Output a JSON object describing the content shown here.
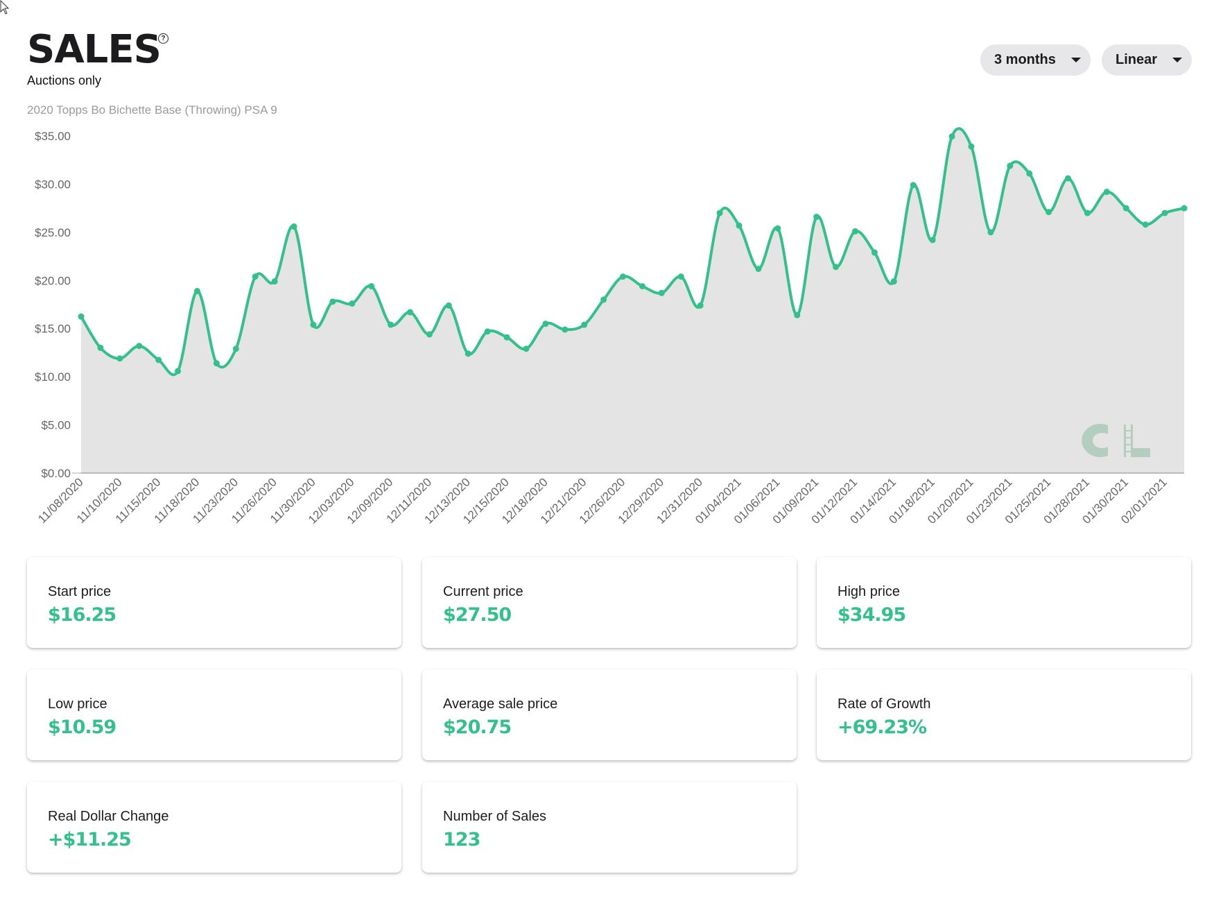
{
  "header": {
    "title": "SALES",
    "help_icon": "question-circle-icon",
    "subtitle": "Auctions only",
    "card_name": "2020 Topps Bo Bichette Base (Throwing) PSA 9"
  },
  "controls": {
    "range_label": "3 months",
    "scale_label": "Linear"
  },
  "colors": {
    "accent": "#32c08b",
    "area_fill": "#e4e4e4",
    "text": "#1c1c1e"
  },
  "chart_data": {
    "type": "area",
    "title": "",
    "xlabel": "",
    "ylabel": "",
    "ylim": [
      0,
      35
    ],
    "y_ticks": [
      "$0.00",
      "$5.00",
      "$10.00",
      "$15.00",
      "$20.00",
      "$25.00",
      "$30.00",
      "$35.00"
    ],
    "y_tick_values": [
      0,
      5,
      10,
      15,
      20,
      25,
      30,
      35
    ],
    "x_tick_labels": [
      "11/08/2020",
      "11/10/2020",
      "11/15/2020",
      "11/18/2020",
      "11/23/2020",
      "11/26/2020",
      "11/30/2020",
      "12/03/2020",
      "12/09/2020",
      "12/11/2020",
      "12/13/2020",
      "12/15/2020",
      "12/18/2020",
      "12/21/2020",
      "12/26/2020",
      "12/29/2020",
      "12/31/2020",
      "01/04/2021",
      "01/06/2021",
      "01/09/2021",
      "01/12/2021",
      "01/14/2021",
      "01/18/2021",
      "01/20/2021",
      "01/23/2021",
      "01/25/2021",
      "01/28/2021",
      "01/30/2021",
      "02/01/2021"
    ],
    "x_tick_every": 2,
    "values": [
      16.25,
      13.0,
      11.9,
      13.2,
      11.75,
      10.59,
      18.9,
      11.4,
      12.9,
      20.4,
      19.9,
      25.6,
      15.4,
      17.8,
      17.6,
      19.4,
      15.4,
      16.7,
      14.4,
      17.4,
      12.4,
      14.7,
      14.1,
      12.9,
      15.5,
      14.9,
      15.4,
      18.0,
      20.4,
      19.4,
      18.7,
      20.4,
      17.4,
      27.0,
      25.7,
      21.2,
      25.4,
      16.4,
      26.6,
      21.4,
      25.1,
      22.9,
      19.9,
      29.9,
      24.2,
      34.95,
      33.9,
      25.0,
      31.9,
      31.1,
      27.1,
      30.6,
      27.0,
      29.2,
      27.5,
      25.8,
      27.0,
      27.5
    ],
    "grid": false,
    "legend": "none",
    "watermark": "CL"
  },
  "stats": [
    {
      "label": "Start price",
      "value": "$16.25"
    },
    {
      "label": "Current price",
      "value": "$27.50"
    },
    {
      "label": "High price",
      "value": "$34.95"
    },
    {
      "label": "Low price",
      "value": "$10.59"
    },
    {
      "label": "Average sale price",
      "value": "$20.75"
    },
    {
      "label": "Rate of Growth",
      "value": "+69.23%"
    },
    {
      "label": "Real Dollar Change",
      "value": "+$11.25"
    },
    {
      "label": "Number of Sales",
      "value": "123"
    }
  ]
}
